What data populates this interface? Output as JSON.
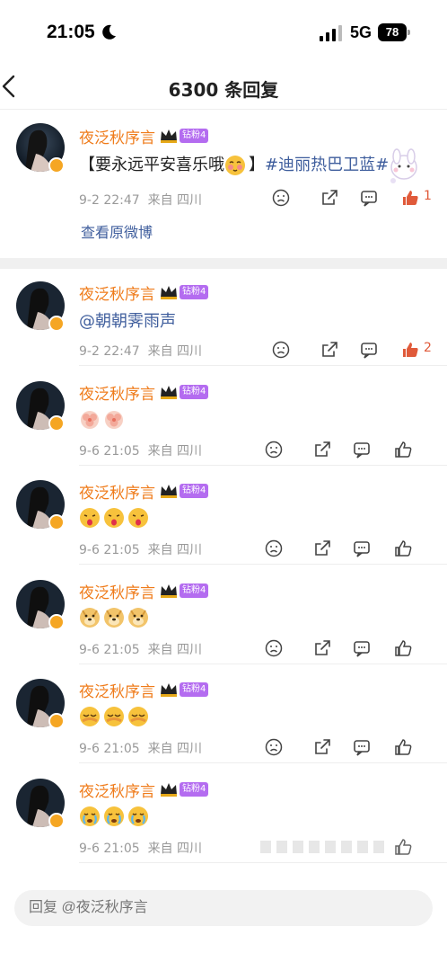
{
  "status": {
    "time": "21:05",
    "network": "5G",
    "battery": "78"
  },
  "header": {
    "title": "6300 条回复"
  },
  "main_comment": {
    "user": "夜泛秋序言",
    "badge": "钻粉4",
    "text_prefix": "【要永远平安喜乐哦",
    "text_suffix": "】",
    "topic": "#迪丽热巴卫蓝#",
    "time": "9-2 22:47",
    "source": "来自 四川",
    "likes": "1",
    "view_original": "查看原微博"
  },
  "replies": [
    {
      "user": "夜泛秋序言",
      "badge": "钻粉4",
      "text": "@朝朝霁雨声",
      "time": "9-2 22:47",
      "source": "来自 四川",
      "likes": "2",
      "emoji": "",
      "emoji_count": 0
    },
    {
      "user": "夜泛秋序言",
      "badge": "钻粉4",
      "text": "",
      "time": "9-6 21:05",
      "source": "来自 四川",
      "likes": "",
      "emoji": "peach-heart",
      "emoji_count": 2
    },
    {
      "user": "夜泛秋序言",
      "badge": "钻粉4",
      "text": "",
      "time": "9-6 21:05",
      "source": "来自 四川",
      "likes": "",
      "emoji": "kiss",
      "emoji_count": 3
    },
    {
      "user": "夜泛秋序言",
      "badge": "钻粉4",
      "text": "",
      "time": "9-6 21:05",
      "source": "来自 四川",
      "likes": "",
      "emoji": "doge",
      "emoji_count": 3
    },
    {
      "user": "夜泛秋序言",
      "badge": "钻粉4",
      "text": "",
      "time": "9-6 21:05",
      "source": "来自 四川",
      "likes": "",
      "emoji": "pleading",
      "emoji_count": 3
    },
    {
      "user": "夜泛秋序言",
      "badge": "钻粉4",
      "text": "",
      "time": "9-6 21:05",
      "source": "来自 四川",
      "likes": "",
      "emoji": "crying",
      "emoji_count": 3
    }
  ],
  "reply_bar": {
    "placeholder": "回复 @夜泛秋序言"
  },
  "colors": {
    "username": "#ef7b1a",
    "link": "#3f5e9d",
    "badge": "#b46cf0",
    "like": "#e05a3a"
  }
}
